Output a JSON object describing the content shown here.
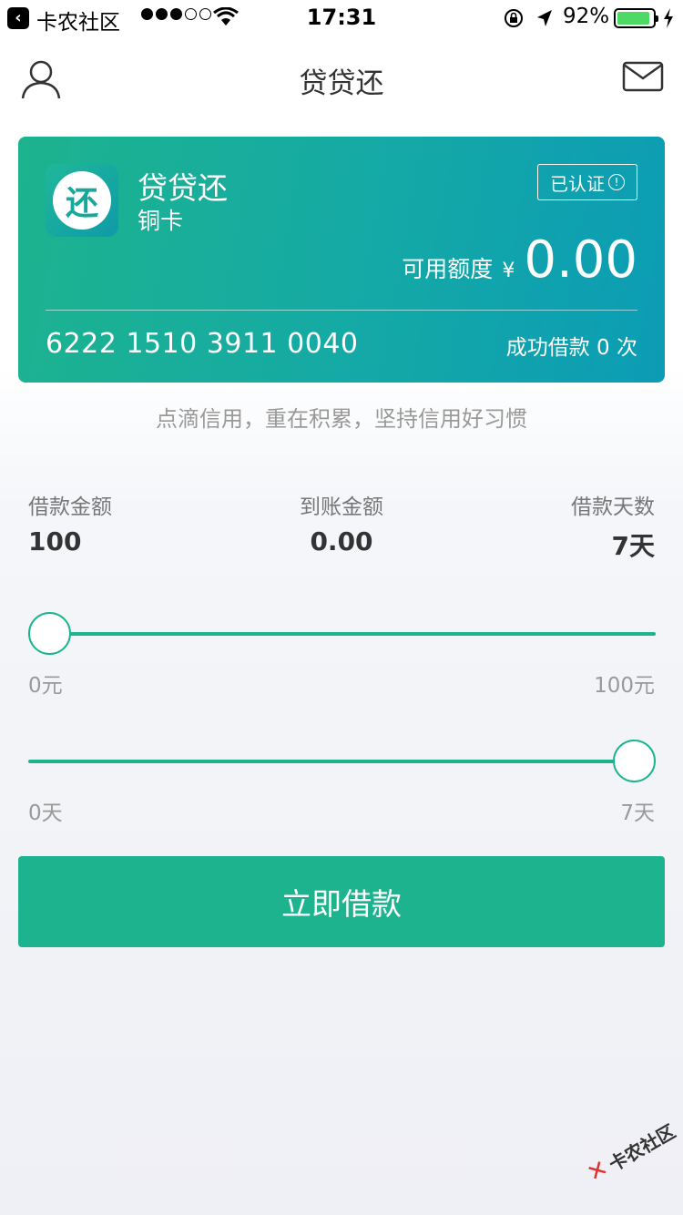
{
  "status_bar": {
    "carrier": "卡农社区",
    "signal_bars_filled": 3,
    "signal_bars_total": 5,
    "time": "17:31",
    "battery_percent": "92%",
    "battery_level": 0.92
  },
  "nav": {
    "title": "贷贷还",
    "profile_icon": "user-icon",
    "message_icon": "mail-icon"
  },
  "card": {
    "app_icon_glyph": "还",
    "name": "贷贷还",
    "tier": "铜卡",
    "verified_label": "已认证",
    "credit_label": "可用额度",
    "currency": "¥",
    "credit_amount": "0.00",
    "card_number": "6222 1510 3911 0040",
    "success_text": "成功借款 0 次"
  },
  "slogan": "点滴信用，重在积累，坚持信用好习惯",
  "stats": {
    "loan_amount_label": "借款金额",
    "loan_amount_value": "100",
    "received_label": "到账金额",
    "received_value": "0.00",
    "days_label": "借款天数",
    "days_value": "7天"
  },
  "amount_slider": {
    "min_label": "0元",
    "max_label": "100元",
    "fraction": 0.0
  },
  "days_slider": {
    "min_label": "0天",
    "max_label": "7天",
    "fraction": 1.0
  },
  "submit_label": "立即借款",
  "watermark": "卡农社区",
  "colors": {
    "accent": "#1db38e",
    "card_gradient_end": "#0b9cb5"
  }
}
